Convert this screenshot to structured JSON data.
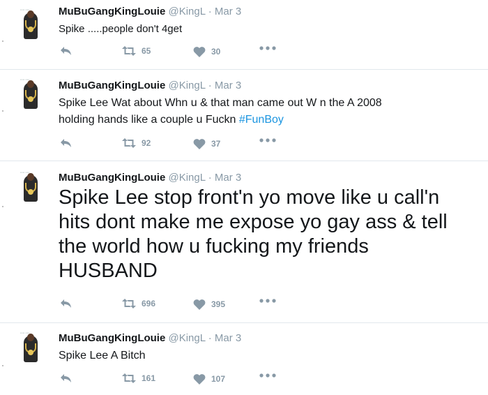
{
  "tweets": [
    {
      "name": "MuBuGangKingLouie",
      "handle": "@KingL",
      "sep": "·",
      "date": "Mar 3",
      "text_parts": [
        "Spike .....people don't 4get"
      ],
      "retweets": "65",
      "likes": "30"
    },
    {
      "name": "MuBuGangKingLouie",
      "handle": "@KingL",
      "sep": "·",
      "date": "Mar 3",
      "text_line1": "Spike Lee Wat about Whn u & that man came out W n the A 2008",
      "text_line2": "holding hands like a couple u Fuckn ",
      "hashtag": "#FunBoy",
      "retweets": "92",
      "likes": "37"
    },
    {
      "name": "MuBuGangKingLouie",
      "handle": "@KingL",
      "sep": "·",
      "date": "Mar 3",
      "text_lines": [
        "Spike Lee stop front'n  yo move like u call'n",
        "hits dont make me expose yo gay ass & tell",
        "the world how u fucking my friends",
        "HUSBAND"
      ],
      "retweets": "696",
      "likes": "395"
    },
    {
      "name": "MuBuGangKingLouie",
      "handle": "@KingL",
      "sep": "·",
      "date": "Mar 3",
      "text_parts": [
        "Spike Lee A Bitch"
      ],
      "retweets": "161",
      "likes": "107"
    }
  ],
  "icons": {
    "reply": "reply-icon",
    "retweet": "retweet-icon",
    "like": "heart-icon",
    "more": "more-icon"
  },
  "colors": {
    "text": "#14171a",
    "meta": "#8899a6",
    "hashtag": "#1b95e0",
    "divider": "#e1e8ed"
  }
}
